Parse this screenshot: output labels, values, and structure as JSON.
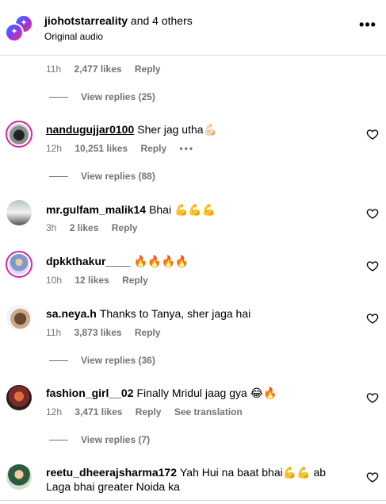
{
  "header": {
    "username": "jiohotstarreality",
    "others": "and 4 others",
    "audio": "Original audio",
    "more_icon": "more-horizontal-icon"
  },
  "top_comment_meta": {
    "time": "11h",
    "likes": "2,477 likes",
    "reply": "Reply",
    "view_replies": "View replies (25)"
  },
  "comments": [
    {
      "username": "nandugujjar0100",
      "text": "Sher jag utha💪🏻",
      "time": "12h",
      "likes": "10,251 likes",
      "reply": "Reply",
      "more": "•••",
      "view_replies": "View replies (88)"
    },
    {
      "username": "mr.gulfam_malik14",
      "text": "Bhai 💪💪💪",
      "time": "3h",
      "likes": "2 likes",
      "reply": "Reply"
    },
    {
      "username": "dpkkthakur____",
      "text": "🔥🔥🔥🔥",
      "time": "10h",
      "likes": "12 likes",
      "reply": "Reply"
    },
    {
      "username": "sa.neya.h",
      "text": "Thanks to Tanya, sher jaga hai",
      "time": "11h",
      "likes": "3,873 likes",
      "reply": "Reply",
      "view_replies": "View replies (36)"
    },
    {
      "username": "fashion_girl__02",
      "text": "Finally Mridul jaag gya 😂🔥",
      "time": "12h",
      "likes": "3,471 likes",
      "reply": "Reply",
      "translate": "See translation",
      "view_replies": "View replies (7)"
    },
    {
      "username": "reetu_dheerajsharma172",
      "text": "Yah Hui na baat bhai💪💪 ab Laga bhai greater Noida ka"
    }
  ],
  "colors": {
    "secondary_text": "#737373",
    "divider": "#dbdbdb",
    "story_ring": "#d6249f"
  }
}
